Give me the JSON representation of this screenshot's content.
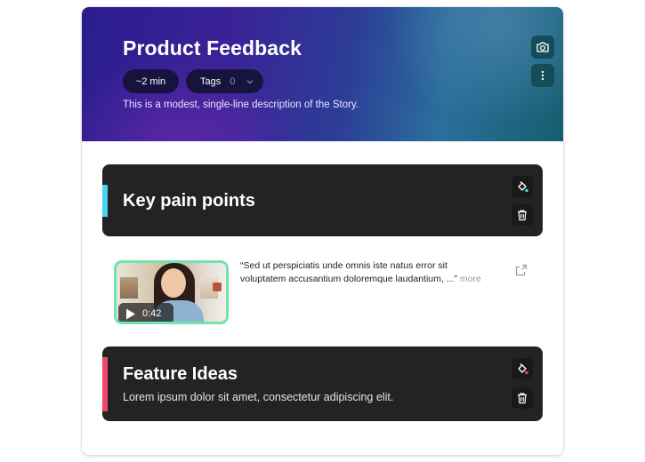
{
  "header": {
    "title": "Product Feedback",
    "duration": "~2 min",
    "tags_label": "Tags",
    "tags_count": "0",
    "description": "This is a modest, single-line description of the Story."
  },
  "sections": [
    {
      "title": "Key pain points",
      "accent_color": "#47d5ef",
      "paint_dot_color": "#47d5ef"
    },
    {
      "title": "Feature Ideas",
      "description": "Lorem ipsum dolor sit amet, consectetur adipiscing elit.",
      "accent_color": "#f0466e",
      "paint_dot_color": "#f0466e"
    }
  ],
  "clip": {
    "duration": "0:42",
    "quote": "“Sed ut perspiciatis unde omnis iste natus error sit voluptatem accusantium doloremque laudantium, ...”",
    "more_label": "more",
    "border_color": "#6fe3b0"
  },
  "icons": {
    "camera": "camera-icon",
    "more": "more-vertical-icon",
    "chevron": "chevron-down-icon",
    "paint": "paint-bucket-icon",
    "trash": "trash-icon",
    "play": "play-icon",
    "share": "share-icon"
  }
}
